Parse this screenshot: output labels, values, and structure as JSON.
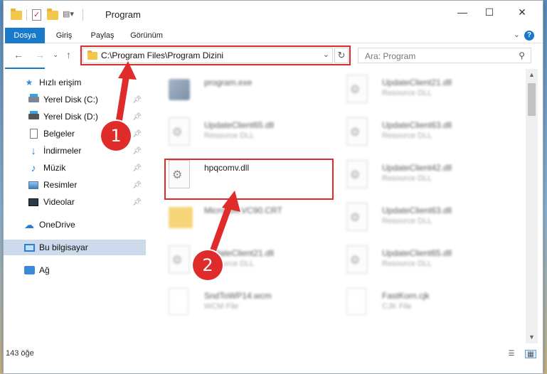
{
  "window": {
    "title": "Program",
    "controls": {
      "minimize": "—",
      "maximize": "☐",
      "close": "✕"
    }
  },
  "ribbon": {
    "tabs": [
      "Dosya",
      "Giriş",
      "Paylaş",
      "Görünüm"
    ],
    "help": "?"
  },
  "nav": {
    "address": "C:\\Program Files\\Program Dizini",
    "search_placeholder": "Ara: Program"
  },
  "sidebar": {
    "items": [
      {
        "label": "Hızlı erişim",
        "icon": "star-icon"
      },
      {
        "label": "Yerel Disk (C:)",
        "icon": "drive-icon",
        "pinned": true
      },
      {
        "label": "Yerel Disk (D:)",
        "icon": "drive-icon",
        "pinned": true
      },
      {
        "label": "Belgeler",
        "icon": "documents-icon",
        "pinned": true
      },
      {
        "label": "İndirmeler",
        "icon": "download-icon",
        "pinned": true
      },
      {
        "label": "Müzik",
        "icon": "music-icon",
        "pinned": true
      },
      {
        "label": "Resimler",
        "icon": "pictures-icon",
        "pinned": true
      },
      {
        "label": "Videolar",
        "icon": "videos-icon",
        "pinned": true
      },
      {
        "label": "OneDrive",
        "icon": "cloud-icon"
      },
      {
        "label": "Bu bilgisayar",
        "icon": "computer-icon",
        "selected": true
      },
      {
        "label": "Ağ",
        "icon": "network-icon"
      }
    ]
  },
  "files": [
    {
      "name": "program.exe",
      "type": "",
      "icon": "exe-icon"
    },
    {
      "name": "UpdateClient21.dll",
      "type": "Resource DLL",
      "icon": "dll-icon"
    },
    {
      "name": "UpdateClient65.dll",
      "type": "Resource DLL",
      "icon": "dll-icon"
    },
    {
      "name": "UpdateClient63.dll",
      "type": "Resource DLL",
      "icon": "dll-icon"
    },
    {
      "name": "hpqcomv.dll",
      "type": "",
      "icon": "dll-icon"
    },
    {
      "name": "UpdateClient42.dll",
      "type": "Resource DLL",
      "icon": "dll-icon"
    },
    {
      "name": "Microsoft.VC90.CRT",
      "type": "",
      "icon": "folder-icon"
    },
    {
      "name": "UpdateClient63.dll",
      "type": "Resource DLL",
      "icon": "dll-icon"
    },
    {
      "name": "UpdateClient21.dll",
      "type": "Resource DLL",
      "icon": "dll-icon"
    },
    {
      "name": "UpdateClient65.dll",
      "type": "Resource DLL",
      "icon": "dll-icon"
    },
    {
      "name": "SndToWP14.wcm",
      "type": "WCM File",
      "icon": "file-icon"
    },
    {
      "name": "FastKorn.cjk",
      "type": "CJK File",
      "icon": "file-icon"
    }
  ],
  "status": {
    "count": "143 öğe"
  },
  "annotations": {
    "step1": "1",
    "step2": "2",
    "accent": "#e02b2b"
  }
}
